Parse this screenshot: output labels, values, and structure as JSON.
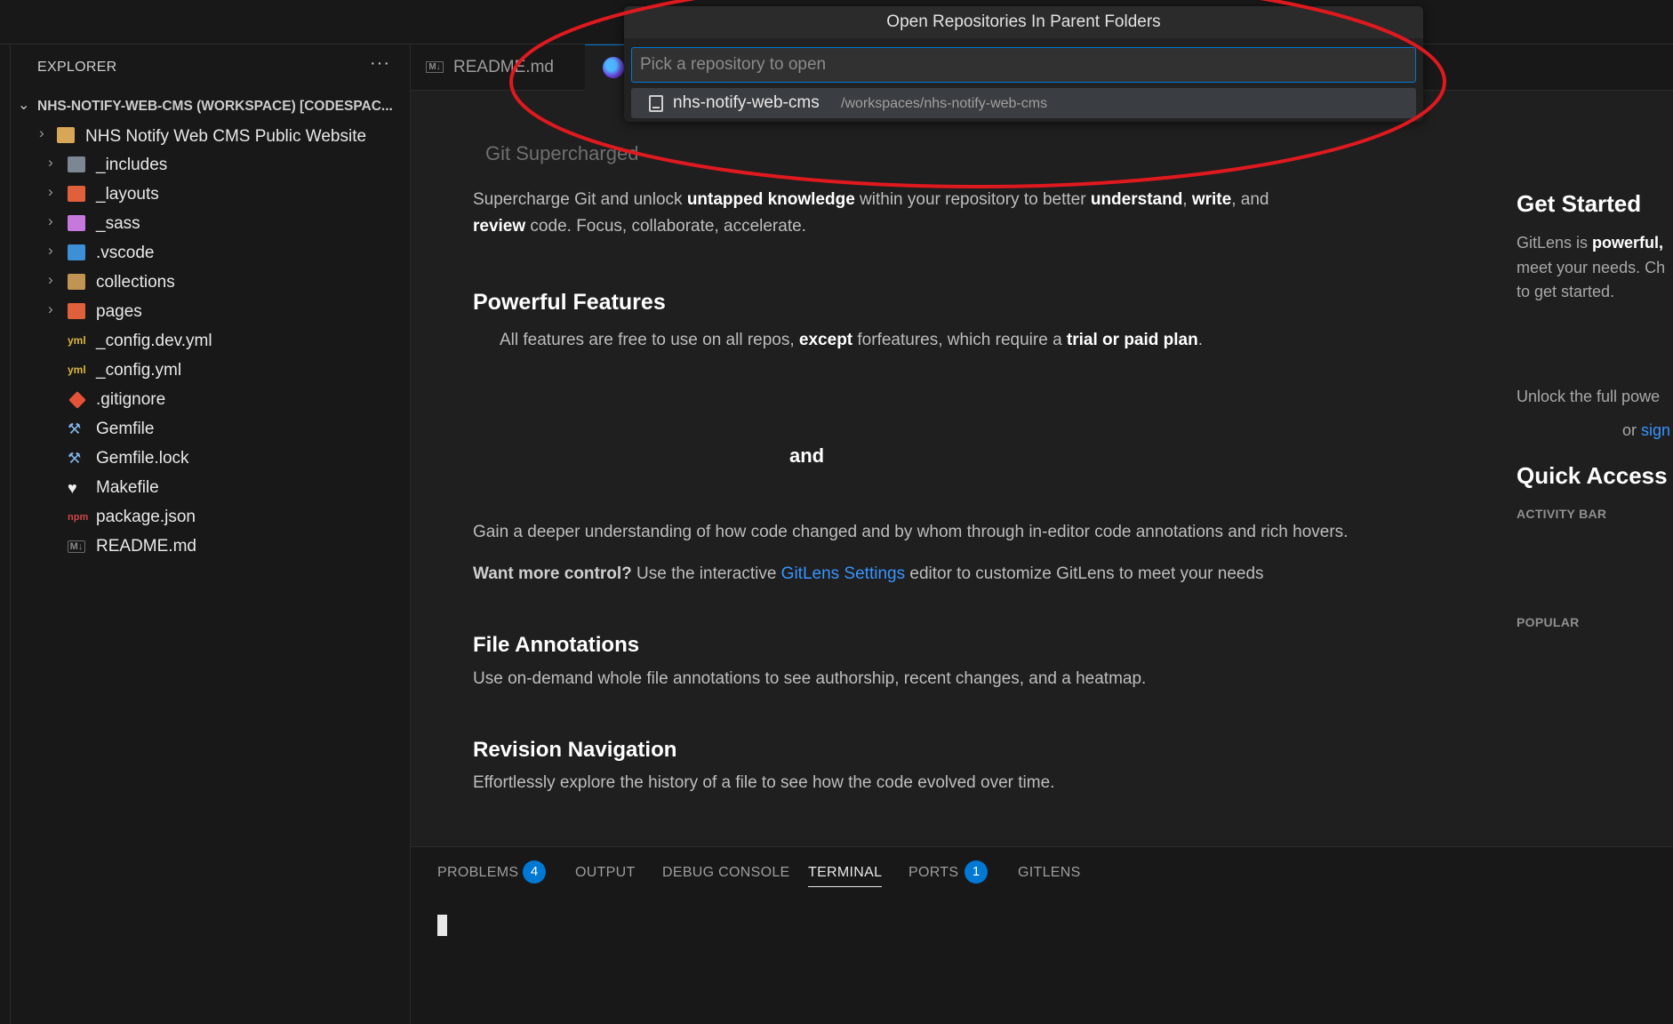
{
  "quick_pick": {
    "title": "Open Repositories In Parent Folders",
    "placeholder": "Pick a repository to open",
    "items": [
      {
        "name": "nhs-notify-web-cms",
        "path": "/workspaces/nhs-notify-web-cms",
        "icon": "repo-icon"
      }
    ]
  },
  "sidebar": {
    "title": "EXPLORER",
    "more": "···",
    "workspace": "NHS-NOTIFY-WEB-CMS (WORKSPACE) [CODESPAC...",
    "root_folder": "NHS Notify Web CMS Public Website",
    "items": [
      {
        "label": "_includes",
        "type": "folder",
        "icon": "folder-includes-icon"
      },
      {
        "label": "_layouts",
        "type": "folder",
        "icon": "folder-layouts-icon"
      },
      {
        "label": "_sass",
        "type": "folder",
        "icon": "folder-sass-icon"
      },
      {
        "label": ".vscode",
        "type": "folder",
        "icon": "folder-vscode-icon"
      },
      {
        "label": "collections",
        "type": "folder",
        "icon": "folder-icon"
      },
      {
        "label": "pages",
        "type": "folder",
        "icon": "folder-pages-icon"
      },
      {
        "label": "_config.dev.yml",
        "type": "file",
        "icon": "yaml-icon"
      },
      {
        "label": "_config.yml",
        "type": "file",
        "icon": "yaml-icon"
      },
      {
        "label": ".gitignore",
        "type": "file",
        "icon": "git-icon"
      },
      {
        "label": "Gemfile",
        "type": "file",
        "icon": "ruby-icon"
      },
      {
        "label": "Gemfile.lock",
        "type": "file",
        "icon": "ruby-icon"
      },
      {
        "label": "Makefile",
        "type": "file",
        "icon": "makefile-icon"
      },
      {
        "label": "package.json",
        "type": "file",
        "icon": "npm-icon"
      },
      {
        "label": "README.md",
        "type": "file",
        "icon": "markdown-icon"
      }
    ]
  },
  "tabs": {
    "readme_label": "README.md",
    "md_badge": "M↓"
  },
  "editor": {
    "subtitle": "Git Supercharged",
    "intro": {
      "p1": "Supercharge Git and unlock ",
      "b1": "untapped knowledge",
      "p2": " within your repository to better ",
      "b2": "understand",
      "p3": ", ",
      "b3": "write",
      "p4": ", and",
      "b4": "review",
      "p5": " code. Focus, collaborate, accelerate."
    },
    "features_heading": "Powerful Features",
    "features_line": {
      "p1": "All features are free to use on all repos, ",
      "b1": "except",
      "p2": " forfeatures, which require a ",
      "b2": "trial or paid plan",
      "p3": "."
    },
    "and_text": "and",
    "understanding": "Gain a deeper understanding of how code changed and by whom through in-editor code annotations and rich hovers.",
    "control": {
      "b1": "Want more control?",
      "p1": " Use the interactive ",
      "link": "GitLens Settings",
      "p2": " editor to customize GitLens to meet your needs"
    },
    "file_annotations_heading": "File Annotations",
    "file_annotations_text": "Use on-demand whole file annotations to see authorship, recent changes, and a heatmap.",
    "revision_heading": "Revision Navigation",
    "revision_text": "Effortlessly explore the history of a file to see how the code evolved over time.",
    "right": {
      "get_started": "Get Started",
      "gs_l1a": "GitLens is ",
      "gs_l1b": "powerful,",
      "gs_l2": "meet your needs. Ch",
      "gs_l3": "to get started.",
      "unlock": "Unlock the full powe",
      "or": "or ",
      "sign": "sign",
      "quick_access": "Quick Access",
      "activity_bar": "ACTIVITY BAR",
      "popular": "POPULAR"
    }
  },
  "panel": {
    "tabs": [
      {
        "label": "PROBLEMS",
        "badge": "4"
      },
      {
        "label": "OUTPUT"
      },
      {
        "label": "DEBUG CONSOLE"
      },
      {
        "label": "TERMINAL",
        "active": true
      },
      {
        "label": "PORTS",
        "badge": "1"
      },
      {
        "label": "GITLENS"
      }
    ]
  },
  "colors": {
    "accent": "#0078d4",
    "link": "#3794ff",
    "annotation": "#e0191f"
  }
}
